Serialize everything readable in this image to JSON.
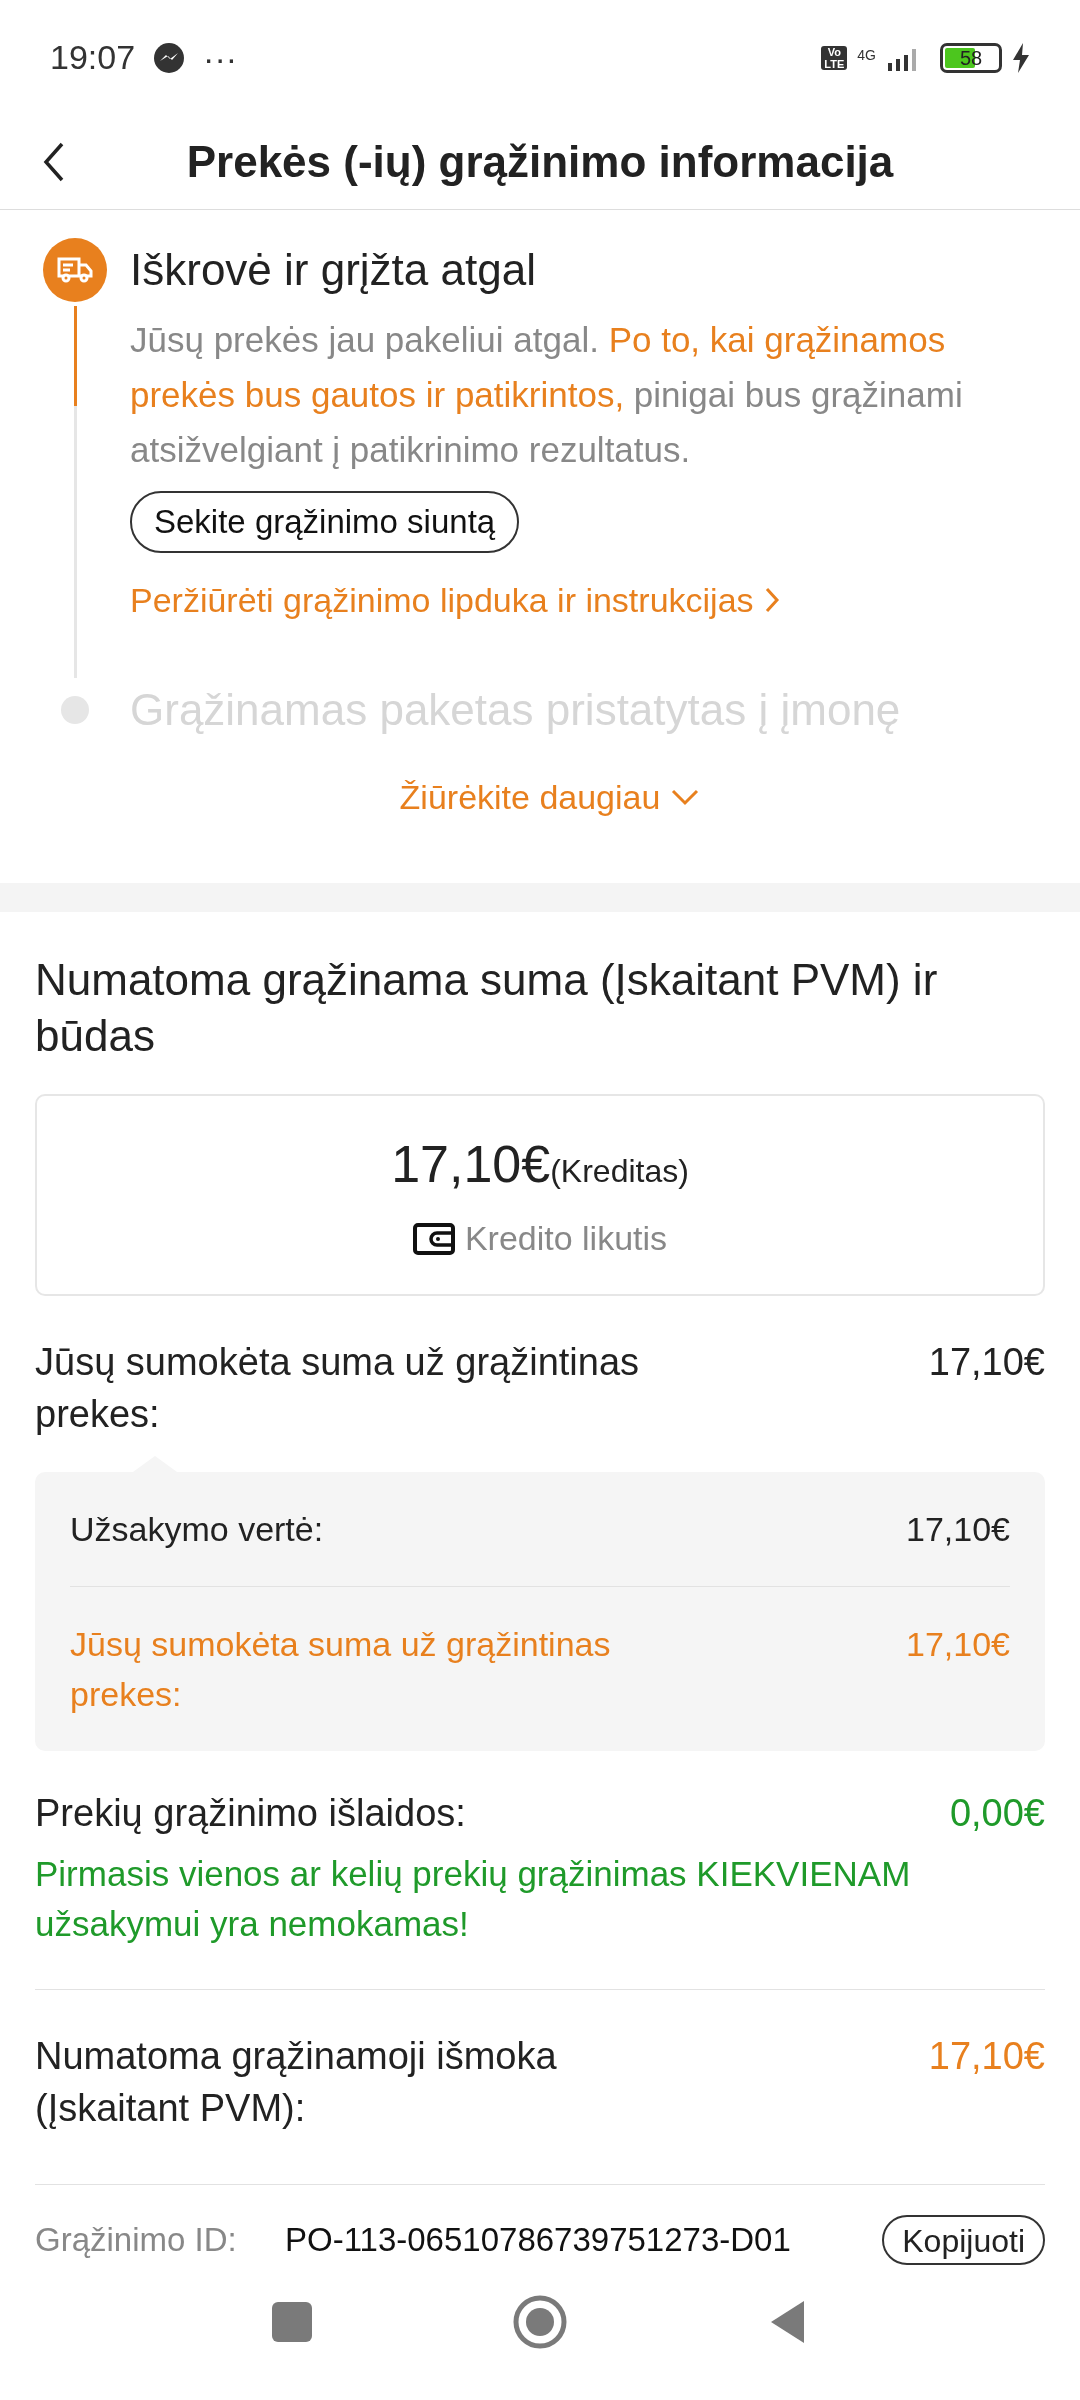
{
  "status_bar": {
    "time": "19:07",
    "more": "···",
    "volte": [
      "Vo",
      "LTE"
    ],
    "network": "4G",
    "battery": {
      "text": "58",
      "level": 0.58,
      "charging": true
    }
  },
  "header": {
    "title": "Prekės (-ių) grąžinimo informacija"
  },
  "timeline": {
    "steps": [
      {
        "kind": "current",
        "title": "Iškrovė ir grįžta atgal",
        "description": [
          {
            "text": "Jūsų prekės jau pakeliui atgal. ",
            "highlight": false
          },
          {
            "text": "Po to, kai grąžinamos prekės bus gautos ir patikrintos,",
            "highlight": true
          },
          {
            "text": " pinigai bus grąžinami atsižvelgiant į patikrinimo rezultatus.",
            "highlight": false
          }
        ],
        "button": "Sekite grąžinimo siuntą",
        "link": "Peržiūrėti grąžinimo lipduka ir instrukcijas"
      },
      {
        "kind": "pending",
        "title": "Grąžinamas paketas pristatytas į įmonę"
      }
    ],
    "more": "Žiūrėkite daugiau"
  },
  "refund": {
    "heading": "Numatoma grąžinama suma (Įskaitant PVM) ir būdas",
    "amount": "17,10€",
    "amount_note": "(Kreditas)",
    "method": "Kredito likutis",
    "paid": {
      "label": "Jūsų sumokėta suma už grąžintinas prekes:",
      "value": "17,10€"
    },
    "breakdown": [
      {
        "label": "Užsakymo vertė:",
        "value": "17,10€",
        "color": "#222222"
      },
      {
        "label": "Jūsų sumokėta suma už grąžintinas prekes:",
        "value": "17,10€",
        "color": "#e8801e"
      }
    ],
    "shipping": {
      "label": "Prekių grąžinimo išlaidos:",
      "value": "0,00€",
      "color": "#1f9a2a",
      "note": "Pirmasis vienos ar kelių prekių grąžinimas KIEKVIENAM užsakymui yra nemokamas!"
    },
    "estimate": {
      "label": "Numatoma grąžinamoji išmoka (Įskaitant PVM):",
      "value": "17,10€",
      "color": "#e8801e"
    },
    "return_id": {
      "label": "Grąžinimo ID:",
      "value": "PO-113-06510786739751273-D01",
      "copy": "Kopijuoti"
    }
  }
}
